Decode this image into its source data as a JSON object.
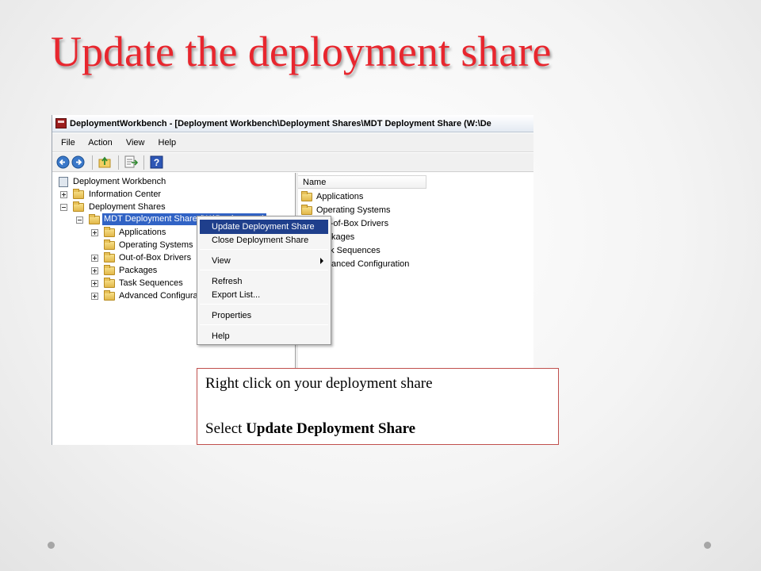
{
  "slide": {
    "title": "Update the deployment share",
    "title_color": "#e8262e"
  },
  "window": {
    "title": "DeploymentWorkbench - [Deployment Workbench\\Deployment Shares\\MDT Deployment Share (W:\\De",
    "menu": [
      "File",
      "Action",
      "View",
      "Help"
    ],
    "toolbar_icons": [
      "back-arrow-icon",
      "forward-arrow-icon",
      "up-folder-icon",
      "export-list-icon",
      "help-icon"
    ]
  },
  "tree": {
    "root": "Deployment Workbench",
    "info_center": "Information Center",
    "deployment_shares": "Deployment Shares",
    "mdt_share": "MDT Deployment Share (W:\\Deployment)",
    "children": [
      "Applications",
      "Operating Systems",
      "Out-of-Box Drivers",
      "Packages",
      "Task Sequences",
      "Advanced Configura"
    ]
  },
  "list": {
    "column_name": "Name",
    "items": [
      "Applications",
      "Operating Systems",
      "Out-of-Box Drivers",
      "Packages",
      "Task Sequences",
      "Advanced Configuration"
    ]
  },
  "context_menu": {
    "items": [
      {
        "label": "Update Deployment Share",
        "highlight": true
      },
      {
        "label": "Close Deployment Share"
      },
      {
        "label": "View",
        "submenu": true
      },
      {
        "label": "Refresh"
      },
      {
        "label": "Export List..."
      },
      {
        "label": "Properties"
      },
      {
        "label": "Help"
      }
    ]
  },
  "callout": {
    "line1": "Right click on your deployment share",
    "line2_prefix": "Select ",
    "line2_bold": "Update Deployment Share",
    "border_color": "#c0504d"
  }
}
